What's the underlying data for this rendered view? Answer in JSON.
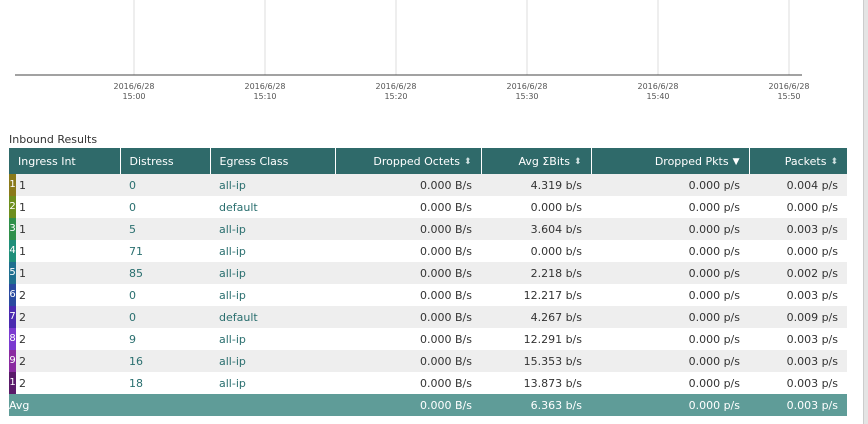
{
  "chart": {
    "x_labels": [
      {
        "date": "2016/6/28",
        "time": "15:00"
      },
      {
        "date": "2016/6/28",
        "time": "15:10"
      },
      {
        "date": "2016/6/28",
        "time": "15:20"
      },
      {
        "date": "2016/6/28",
        "time": "15:30"
      },
      {
        "date": "2016/6/28",
        "time": "15:40"
      },
      {
        "date": "2016/6/28",
        "time": "15:50"
      }
    ]
  },
  "section_title": "Inbound Results",
  "table": {
    "columns": [
      {
        "label": "Ingress Int",
        "sort": "none"
      },
      {
        "label": "Distress",
        "sort": "none"
      },
      {
        "label": "Egress Class",
        "sort": "none"
      },
      {
        "label": "Dropped Octets",
        "sort": "both"
      },
      {
        "label": "Avg ΣBits",
        "sort": "both"
      },
      {
        "label": "Dropped Pkts",
        "sort": "desc"
      },
      {
        "label": "Packets",
        "sort": "both"
      }
    ],
    "sort_icons": {
      "both": "⬍",
      "desc": "▼"
    },
    "rows": [
      {
        "marker": "1",
        "color": "#8a7a1a",
        "ingress": "1",
        "distress": "0",
        "egress": "all-ip",
        "dropped_octets": "0.000 B/s",
        "avg_bits": "4.319 b/s",
        "dropped_pkts": "0.000 p/s",
        "packets": "0.004 p/s"
      },
      {
        "marker": "2",
        "color": "#6e8f1e",
        "ingress": "1",
        "distress": "0",
        "egress": "default",
        "dropped_octets": "0.000 B/s",
        "avg_bits": "0.000 b/s",
        "dropped_pkts": "0.000 p/s",
        "packets": "0.000 p/s"
      },
      {
        "marker": "3",
        "color": "#2f8f4a",
        "ingress": "1",
        "distress": "5",
        "egress": "all-ip",
        "dropped_octets": "0.000 B/s",
        "avg_bits": "3.604 b/s",
        "dropped_pkts": "0.000 p/s",
        "packets": "0.003 p/s"
      },
      {
        "marker": "4",
        "color": "#1f8f7a",
        "ingress": "1",
        "distress": "71",
        "egress": "all-ip",
        "dropped_octets": "0.000 B/s",
        "avg_bits": "0.000 b/s",
        "dropped_pkts": "0.000 p/s",
        "packets": "0.000 p/s"
      },
      {
        "marker": "5",
        "color": "#1f6f8f",
        "ingress": "1",
        "distress": "85",
        "egress": "all-ip",
        "dropped_octets": "0.000 B/s",
        "avg_bits": "2.218 b/s",
        "dropped_pkts": "0.000 p/s",
        "packets": "0.002 p/s"
      },
      {
        "marker": "6",
        "color": "#2a4aa0",
        "ingress": "2",
        "distress": "0",
        "egress": "all-ip",
        "dropped_octets": "0.000 B/s",
        "avg_bits": "12.217 b/s",
        "dropped_pkts": "0.000 p/s",
        "packets": "0.003 p/s"
      },
      {
        "marker": "7",
        "color": "#4a2ab0",
        "ingress": "2",
        "distress": "0",
        "egress": "default",
        "dropped_octets": "0.000 B/s",
        "avg_bits": "4.267 b/s",
        "dropped_pkts": "0.000 p/s",
        "packets": "0.009 p/s"
      },
      {
        "marker": "8",
        "color": "#7a3ad0",
        "ingress": "2",
        "distress": "9",
        "egress": "all-ip",
        "dropped_octets": "0.000 B/s",
        "avg_bits": "12.291 b/s",
        "dropped_pkts": "0.000 p/s",
        "packets": "0.003 p/s"
      },
      {
        "marker": "9",
        "color": "#8a2aa0",
        "ingress": "2",
        "distress": "16",
        "egress": "all-ip",
        "dropped_octets": "0.000 B/s",
        "avg_bits": "15.353 b/s",
        "dropped_pkts": "0.000 p/s",
        "packets": "0.003 p/s"
      },
      {
        "marker": "1",
        "color": "#5a1a6a",
        "ingress": "2",
        "distress": "18",
        "egress": "all-ip",
        "dropped_octets": "0.000 B/s",
        "avg_bits": "13.873 b/s",
        "dropped_pkts": "0.000 p/s",
        "packets": "0.003 p/s"
      }
    ],
    "avg_row": {
      "label": "Avg",
      "dropped_octets": "0.000 B/s",
      "avg_bits": "6.363 b/s",
      "dropped_pkts": "0.000 p/s",
      "packets": "0.003 p/s"
    }
  }
}
